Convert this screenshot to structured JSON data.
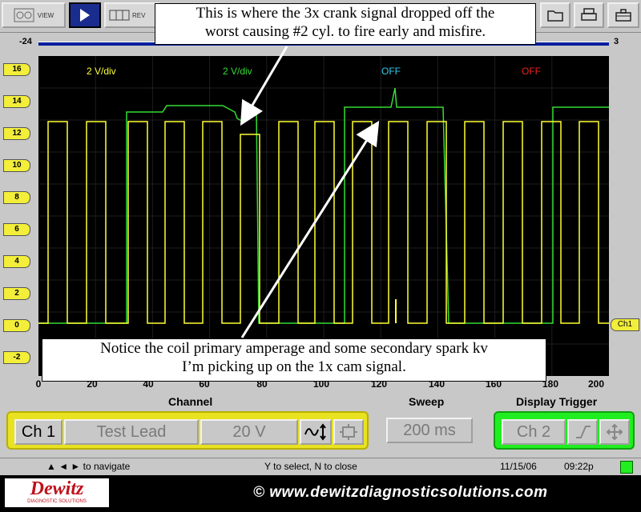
{
  "toolbar": {
    "view_label": "VIEW",
    "review_label": "REV"
  },
  "scale": {
    "left": "-24",
    "right": "3"
  },
  "y_axis": {
    "ticks": [
      "16",
      "14",
      "12",
      "10",
      "8",
      "6",
      "4",
      "2",
      "0",
      "-2"
    ]
  },
  "channels": [
    {
      "label": "2 V/div",
      "color": "#ffff33"
    },
    {
      "label": "2 V/div",
      "color": "#33dd33"
    },
    {
      "label": "OFF",
      "color": "#33ccee"
    },
    {
      "label": "OFF",
      "color": "#ee2222"
    }
  ],
  "x_axis": {
    "ticks": [
      "0",
      "20",
      "40",
      "60",
      "80",
      "100",
      "120",
      "140",
      "160",
      "180",
      "200"
    ]
  },
  "ch1_marker": "Ch1",
  "callouts": {
    "top": [
      "This is where the 3x crank signal dropped off the",
      "worst causing #2 cyl. to fire early and misfire."
    ],
    "bottom": [
      "Notice the coil primary amperage and some secondary spark kv",
      "I’m picking up on the 1x cam signal."
    ]
  },
  "controls": {
    "channel_title": "Channel",
    "sweep_title": "Sweep",
    "trigger_title": "Display Trigger",
    "ch_label": "Ch 1",
    "test_lead": "Test Lead",
    "volts": "20 V",
    "sweep": "200 ms",
    "trigger_ch": "Ch 2"
  },
  "status": {
    "navigate": "▲ ◄ ► to navigate",
    "select": "Y to select, N to close",
    "date": "11/15/06",
    "time": "09:22p"
  },
  "footer": {
    "logo": "Dewitz",
    "logo_sub": "DIAGNOSTIC SOLUTIONS",
    "copyright": "© www.dewitzdiagnosticsolutions.com"
  },
  "colors": {
    "accent_green": "#22ee22",
    "accent_yellow": "#f2ee3a",
    "scope_bg": "#000000"
  }
}
